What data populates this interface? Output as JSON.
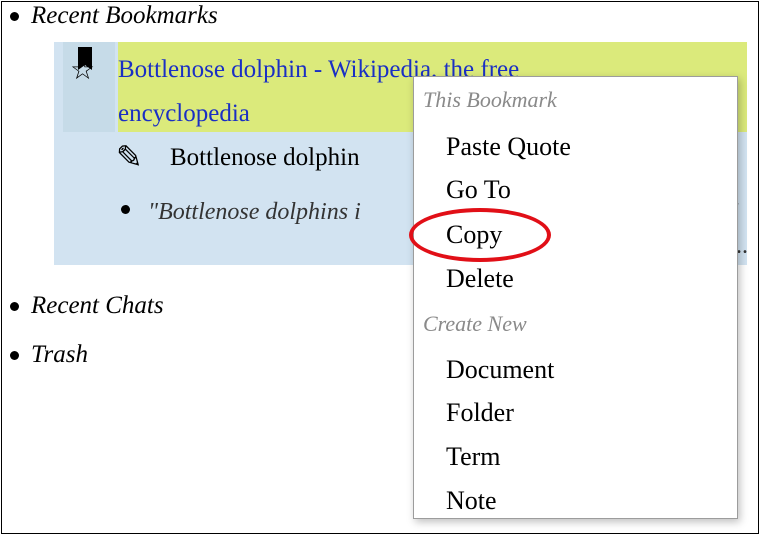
{
  "tree": {
    "recent_bookmarks_label": "Recent Bookmarks",
    "recent_chats_label": "Recent Chats",
    "trash_label": "Trash"
  },
  "bookmark": {
    "title_line1": "Bottlenose dolphin - Wikipedia, the free",
    "title_line2": "encyclopedia",
    "document_title": "Bottlenose dolphin",
    "quote_text": "\"Bottlenose dolphins i",
    "quote_tail": "\" ...",
    "highlight_color": "#dbea7b",
    "panel_color": "#d2e3f1",
    "link_color": "#1a2fc4"
  },
  "icons": {
    "bookmark_flag": "bookmark-flag-icon",
    "star": "star-icon",
    "pencil": "pencil-icon",
    "star_glyph": "☆",
    "pencil_glyph": "✎"
  },
  "context_menu": {
    "section_bookmark": "This Bookmark",
    "items_bookmark": [
      "Paste Quote",
      "Go To",
      "Copy",
      "Delete"
    ],
    "section_create": "Create New",
    "items_create": [
      "Document",
      "Folder",
      "Term",
      "Note"
    ]
  },
  "annotation": {
    "highlighted_item": "Copy",
    "color": "#e10f17"
  }
}
